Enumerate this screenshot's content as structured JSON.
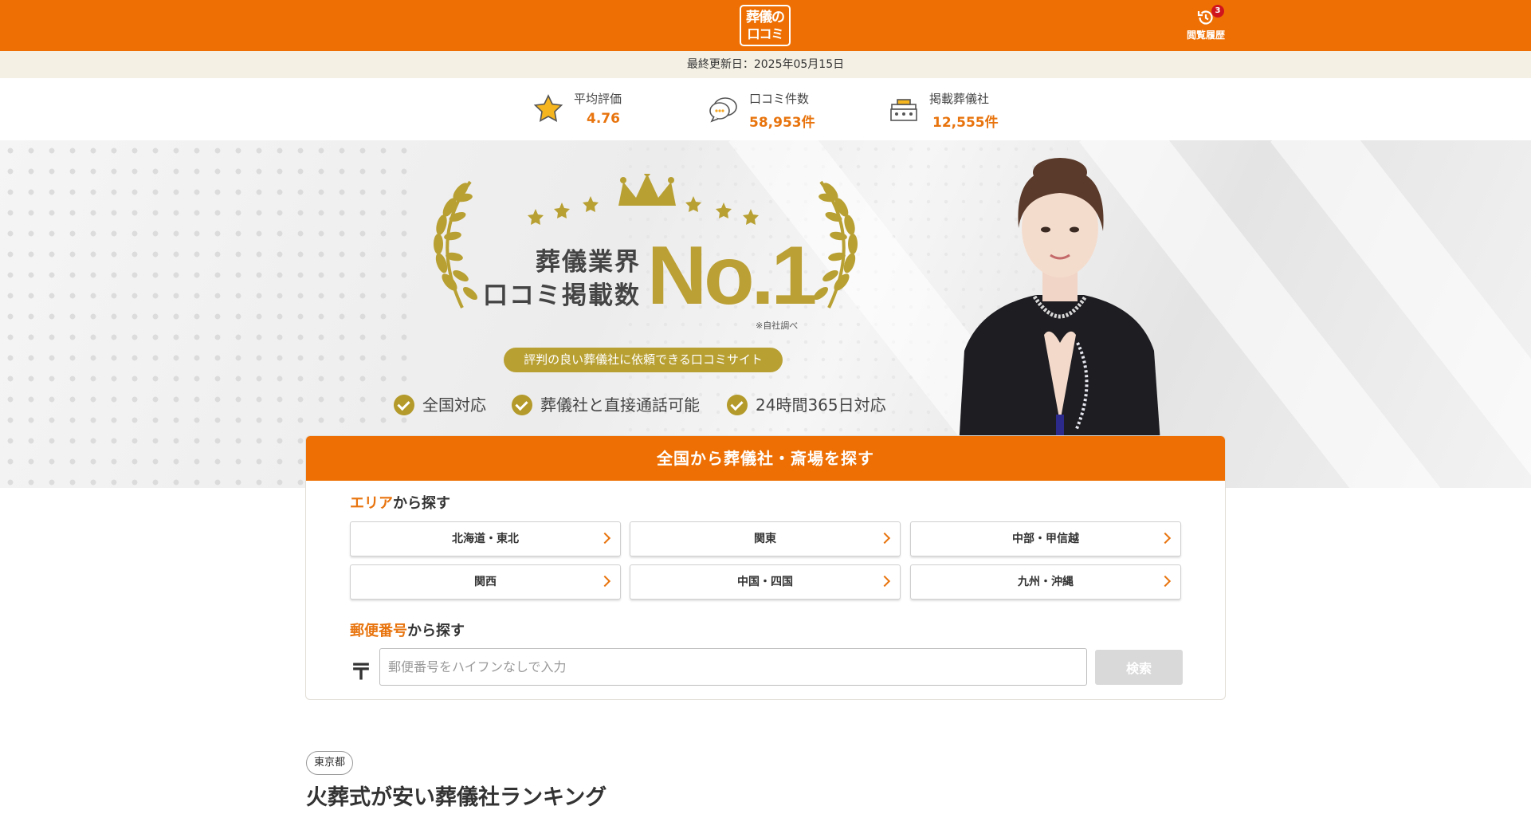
{
  "header": {
    "logo_line1": "葬儀の",
    "logo_line2": "口コミ",
    "history_label": "閲覧履歴",
    "history_count": "3"
  },
  "updated_text": "最終更新日：2025年05月15日",
  "stats": [
    {
      "label": "平均評価",
      "value": "4.76",
      "icon": "star-icon"
    },
    {
      "label": "口コミ件数",
      "value": "58,953件",
      "icon": "chat-bubbles-icon"
    },
    {
      "label": "掲載葬儀社",
      "value": "12,555件",
      "icon": "funeral-hall-icon"
    }
  ],
  "hero": {
    "title_line1": "葬儀業界",
    "title_line2": "口コミ掲載数",
    "no1": "No.1",
    "note": "※自社調べ",
    "tagline": "評判の良い葬儀社に依頼できる口コミサイト",
    "features": [
      "全国対応",
      "葬儀社と直接通話可能",
      "24時間365日対応"
    ]
  },
  "search": {
    "title": "全国から葬儀社・斎場を探す",
    "area_heading_hl": "エリア",
    "area_heading_rest": "から探す",
    "areas": [
      "北海道・東北",
      "関東",
      "中部・甲信越",
      "関西",
      "中国・四国",
      "九州・沖縄"
    ],
    "postal_heading_hl": "郵便番号",
    "postal_heading_rest": "から探す",
    "postal_mark": "〒",
    "postal_placeholder": "郵便番号をハイフンなしで入力",
    "search_label": "検索"
  },
  "ranking": {
    "prefecture": "東京都",
    "title": "火葬式が安い葬儀社ランキング"
  },
  "colors": {
    "brand_orange": "#ee7004",
    "gold": "#b8a033",
    "accent_text": "#e8740e"
  }
}
